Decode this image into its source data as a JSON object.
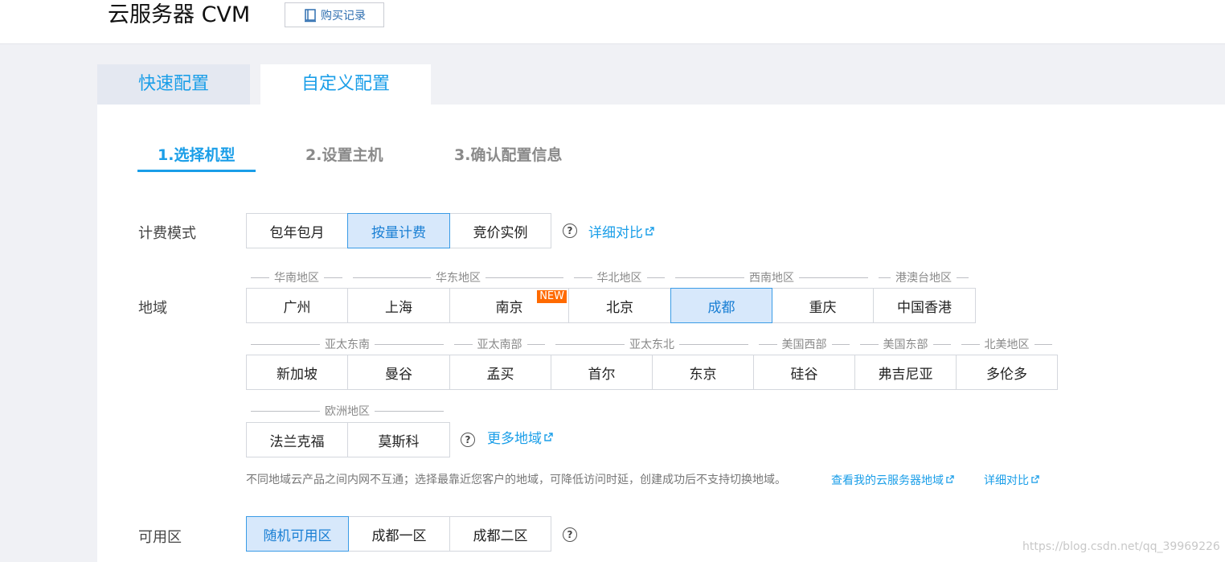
{
  "header": {
    "title": "云服务器 CVM",
    "purchase_record_label": "购买记录",
    "purchase_record_icon": "book-icon"
  },
  "tabs": {
    "quick": "快速配置",
    "custom": "自定义配置",
    "active": "custom"
  },
  "steps": [
    {
      "label": "1.选择机型",
      "active": true
    },
    {
      "label": "2.设置主机",
      "active": false
    },
    {
      "label": "3.确认配置信息",
      "active": false
    }
  ],
  "billing": {
    "label": "计费模式",
    "options": [
      "包年包月",
      "按量计费",
      "竞价实例"
    ],
    "selected": "按量计费",
    "compare_link": "详细对比"
  },
  "region": {
    "label": "地域",
    "groups_row1": [
      "华南地区",
      "华东地区",
      "华北地区",
      "西南地区",
      "港澳台地区"
    ],
    "row1": [
      "广州",
      "上海",
      "南京",
      "北京",
      "成都",
      "重庆",
      "中国香港"
    ],
    "new_badge": "NEW",
    "selected": "成都",
    "groups_row2": [
      "亚太东南",
      "亚太南部",
      "亚太东北",
      "美国西部",
      "美国东部",
      "北美地区"
    ],
    "row2": [
      "新加坡",
      "曼谷",
      "孟买",
      "首尔",
      "东京",
      "硅谷",
      "弗吉尼亚",
      "多伦多"
    ],
    "groups_row3": [
      "欧洲地区"
    ],
    "row3": [
      "法兰克福",
      "莫斯科"
    ],
    "more_link": "更多地域",
    "hint": "不同地域云产品之间内网不互通；选择最靠近您客户的地域，可降低访问时延，创建成功后不支持切换地域。",
    "my_regions_link": "查看我的云服务器地域",
    "compare_link": "详细对比"
  },
  "zone": {
    "label": "可用区",
    "options": [
      "随机可用区",
      "成都一区",
      "成都二区"
    ],
    "selected": "随机可用区"
  },
  "help_glyph": "?",
  "watermark": "https://blog.csdn.net/qq_39969226",
  "colors": {
    "accent": "#1a9ee8",
    "selected_bg": "#d7e8fb",
    "badge": "#ff6a00"
  }
}
